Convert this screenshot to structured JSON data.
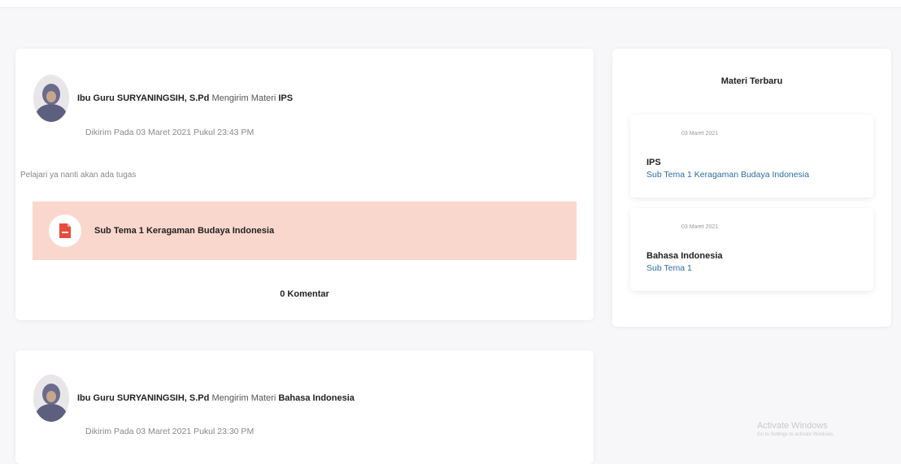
{
  "posts": [
    {
      "teacher": "Ibu Guru SURYANINGSIH, S.Pd",
      "action": "Mengirim Materi",
      "subject": "IPS",
      "sent_at": "Dikirim Pada 03 Maret 2021 Pukul 23:43 PM",
      "message": "Pelajari ya nanti akan ada tugas",
      "attachment_title": "Sub Tema 1 Keragaman Budaya Indonesia",
      "comments": "0 Komentar"
    },
    {
      "teacher": "Ibu Guru SURYANINGSIH, S.Pd",
      "action": "Mengirim Materi",
      "subject": "Bahasa Indonesia",
      "sent_at": "Dikirim Pada 03 Maret 2021 Pukul 23:30 PM"
    }
  ],
  "sidebar": {
    "title": "Materi Terbaru",
    "items": [
      {
        "date": "03 Maret 2021",
        "subject": "IPS",
        "topic": "Sub Tema 1 Keragaman Budaya Indonesia"
      },
      {
        "date": "03 Maret 2021",
        "subject": "Bahasa Indonesia",
        "topic": "Sub Tema 1"
      }
    ]
  },
  "watermark": {
    "line1": "Activate Windows",
    "line2": "Go to Settings to activate Windows."
  },
  "colors": {
    "attachment_bg": "#f9d7cd",
    "pdf_icon": "#e74c3c",
    "link": "#2d6e9c",
    "page_bg": "#f7f7f9"
  },
  "icons": {
    "avatar": "teacher-avatar",
    "attachment": "pdf-file-icon"
  }
}
